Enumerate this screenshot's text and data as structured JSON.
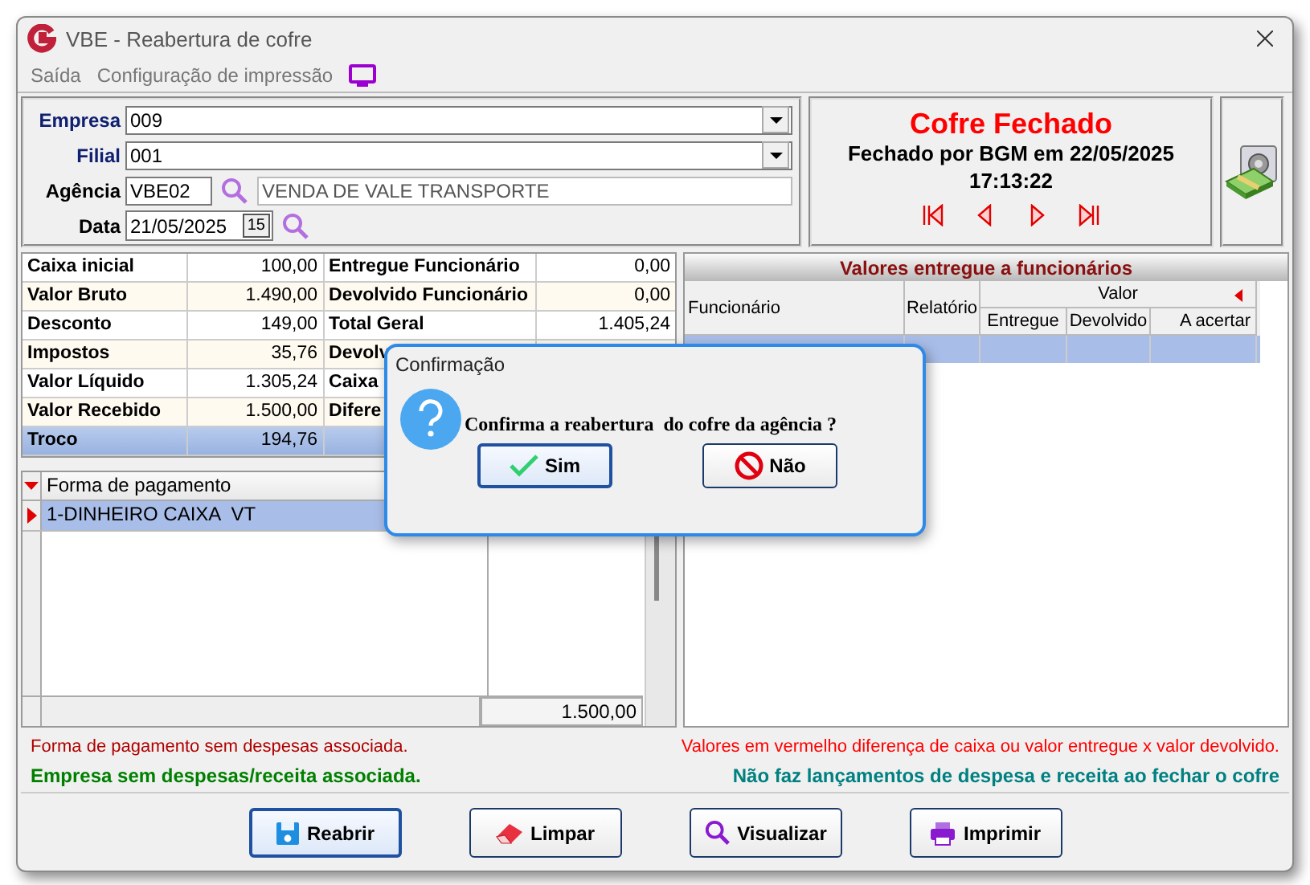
{
  "window": {
    "title": "VBE - Reabertura de cofre"
  },
  "menu": [
    {
      "label": "Saída"
    },
    {
      "label": "Configuração de impressão"
    }
  ],
  "form": {
    "empresa": {
      "label": "Empresa",
      "value": "009"
    },
    "filial": {
      "label": "Filial",
      "value": "001"
    },
    "agencia": {
      "label": "Agência",
      "code": "VBE02",
      "name": "VENDA DE VALE TRANSPORTE"
    },
    "data": {
      "label": "Data",
      "value": "21/05/2025",
      "calendar": "15"
    }
  },
  "status": {
    "title": "Cofre Fechado",
    "detail": "Fechado por BGM em 22/05/2025",
    "time": "17:13:22"
  },
  "summary": [
    {
      "label": "Caixa inicial",
      "value": "100,00",
      "label2": "Entregue Funcionário",
      "value2": "0,00",
      "selected": false
    },
    {
      "label": "Valor Bruto",
      "value": "1.490,00",
      "label2": "Devolvido Funcionário",
      "value2": "0,00",
      "selected": false
    },
    {
      "label": "Desconto",
      "value": "149,00",
      "label2": "Total Geral",
      "value2": "1.405,24",
      "selected": false
    },
    {
      "label": "Impostos",
      "value": "35,76",
      "label2": "Devolv",
      "selected": false
    },
    {
      "label": "Valor Líquido",
      "value": "1.305,24",
      "label2": "Caixa",
      "selected": false
    },
    {
      "label": "Valor Recebido",
      "value": "1.500,00",
      "label2": "Difere",
      "selected": false
    },
    {
      "label": "Troco",
      "value": "194,76",
      "selected": true
    }
  ],
  "payments": {
    "column": "Forma de pagamento",
    "rows": [
      {
        "name": "1-DINHEIRO CAIXA  VT",
        "selected": true
      }
    ],
    "total": "1.500,00"
  },
  "employees": {
    "title": "Valores entregue a funcionários",
    "columns": {
      "funcionario": "Funcionário",
      "relatorio": "Relatório",
      "valor": "Valor",
      "entregue": "Entregue",
      "devolvido": "Devolvido",
      "a_acertar": "A acertar"
    },
    "rows": [
      {
        "selected": true
      }
    ]
  },
  "messages": [
    {
      "text": "Forma de pagamento sem despesas associada.",
      "color": "#b00000",
      "bold": false
    },
    {
      "text": "Valores em vermelho diferença de caixa ou valor entregue x valor devolvido.",
      "color": "#ff0000",
      "bold": false
    },
    {
      "text": "Empresa sem despesas/receita associada.",
      "color": "#008000",
      "bold": true
    },
    {
      "text": "Não faz lançamentos de despesa e receita ao fechar o cofre",
      "color": "#008080",
      "bold": true
    }
  ],
  "buttons": [
    {
      "label": "Reabrir",
      "kind": "save",
      "focused": true
    },
    {
      "label": "Limpar",
      "kind": "eraser",
      "focused": false
    },
    {
      "label": "Visualizar",
      "kind": "search",
      "focused": false
    },
    {
      "label": "Imprimir",
      "kind": "print",
      "focused": false
    }
  ],
  "dialog": {
    "title": "Confirmação",
    "message": "Confirma a reabertura  do cofre da agência ?",
    "buttons": [
      {
        "label": "Sim",
        "kind": "yes",
        "focused": true
      },
      {
        "label": "Não",
        "kind": "no",
        "focused": false
      }
    ]
  }
}
